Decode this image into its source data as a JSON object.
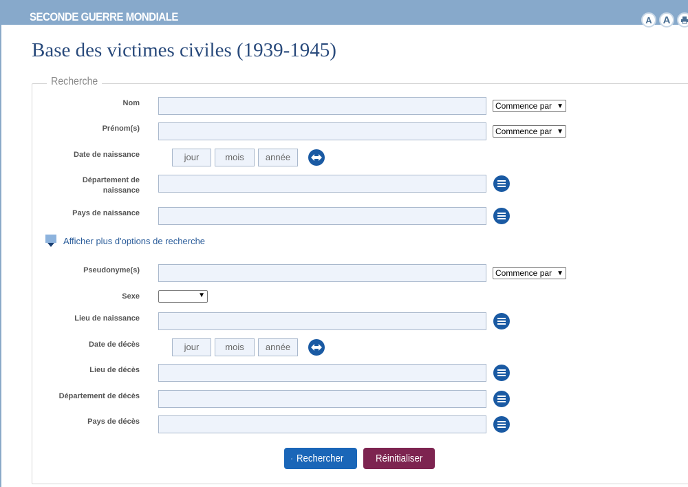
{
  "header": {
    "site_title": "SECONDE GUERRE MONDIALE",
    "tools": [
      "A",
      "A"
    ]
  },
  "page_title": "Base des victimes civiles (1939-1945)",
  "search": {
    "legend": "Recherche",
    "nom_label": "Nom",
    "prenom_label": "Prénom(s)",
    "date_naissance_label": "Date de naissance",
    "dept_naissance_label": "Département de naissance",
    "pays_naissance_label": "Pays de naissance",
    "more_options_link": "Afficher plus d'options de recherche",
    "pseudonyme_label": "Pseudonyme(s)",
    "sexe_label": "Sexe",
    "lieu_naissance_label": "Lieu de naissance",
    "date_deces_label": "Date de décès",
    "lieu_deces_label": "Lieu de décès",
    "dept_deces_label": "Département de décès",
    "pays_deces_label": "Pays de décès",
    "mode_option": "Commence par",
    "date_jour": "jour",
    "date_mois": "mois",
    "date_annee": "année",
    "sexe_value": ""
  },
  "actions": {
    "search_label": "Rechercher",
    "reset_label": "Réinitialiser"
  },
  "colors": {
    "header_bg": "#87a9cb",
    "title": "#2a4b7c",
    "search_button": "#1a66b8",
    "reset_button": "#7d2450",
    "icon_button": "#1a5aa3"
  }
}
